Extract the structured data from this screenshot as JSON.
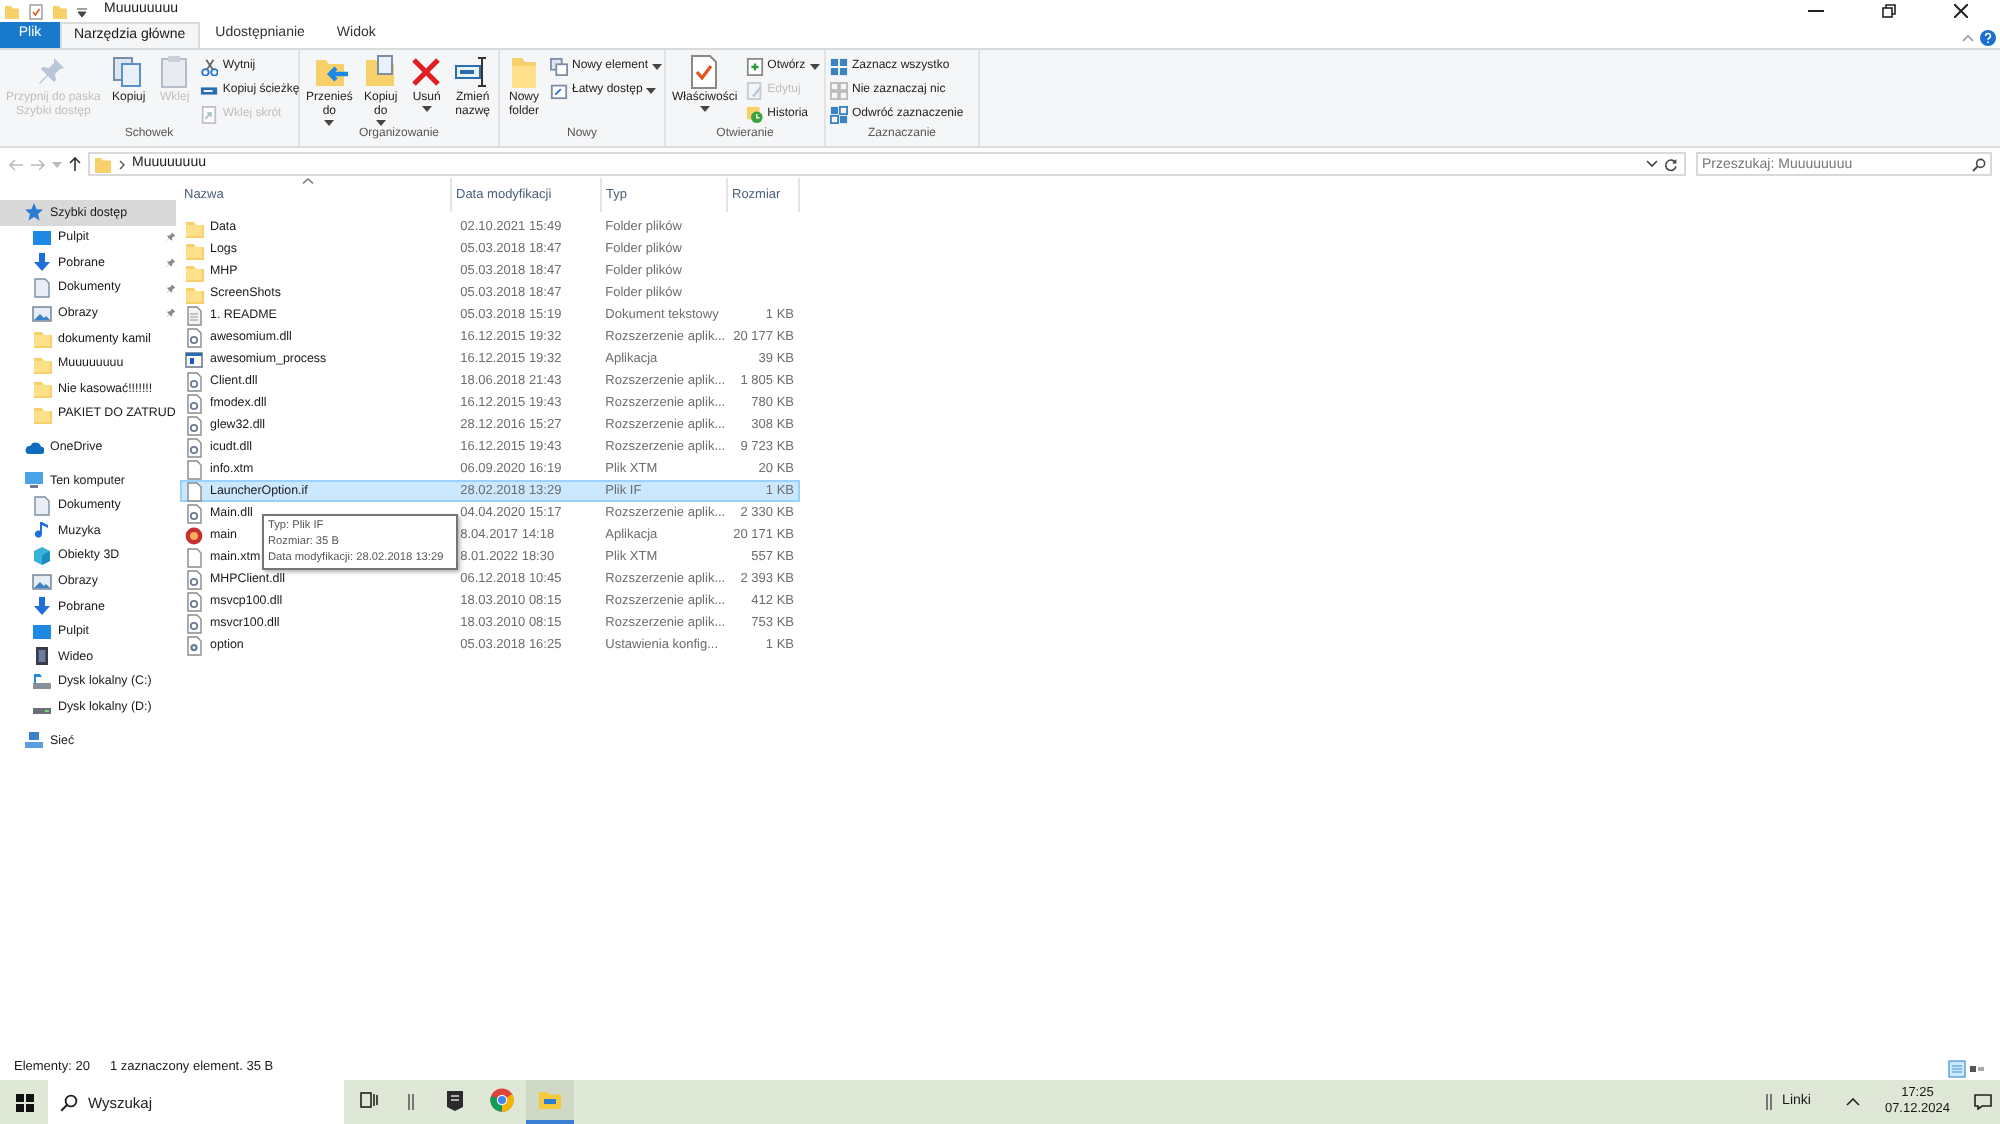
{
  "window": {
    "title": "Muuuuuuuu"
  },
  "tabs": [
    {
      "label": "Plik",
      "kind": "file",
      "selected": false
    },
    {
      "label": "Narzędzia główne",
      "kind": "tab",
      "selected": true
    },
    {
      "label": "Udostępnianie",
      "kind": "tab",
      "selected": false
    },
    {
      "label": "Widok",
      "kind": "tab",
      "selected": false
    }
  ],
  "ribbon": {
    "groups": [
      {
        "label": "Schowek",
        "items": [
          {
            "kind": "big",
            "label": "Przypnij do paska\nSzybki dostęp",
            "disabled": true,
            "dropdown": false
          },
          {
            "kind": "big",
            "label": "Kopiuj",
            "disabled": false,
            "dropdown": false
          },
          {
            "kind": "big",
            "label": "Wklej",
            "disabled": true,
            "dropdown": false
          },
          {
            "kind": "small",
            "label": "Wytnij",
            "disabled": false,
            "dropdown": false
          },
          {
            "kind": "small",
            "label": "Kopiuj ścieżkę",
            "disabled": false,
            "dropdown": false
          },
          {
            "kind": "small",
            "label": "Wklej skrót",
            "disabled": true,
            "dropdown": false
          }
        ]
      },
      {
        "label": "Organizowanie",
        "items": [
          {
            "kind": "big",
            "label": "Przenieś\ndo",
            "disabled": false,
            "dropdown": true
          },
          {
            "kind": "big",
            "label": "Kopiuj\ndo",
            "disabled": false,
            "dropdown": true
          },
          {
            "kind": "big",
            "label": "Usuń",
            "disabled": false,
            "dropdown": true
          },
          {
            "kind": "big",
            "label": "Zmień\nnazwę",
            "disabled": false,
            "dropdown": false
          }
        ]
      },
      {
        "label": "Nowy",
        "items": [
          {
            "kind": "big",
            "label": "Nowy\nfolder",
            "disabled": false,
            "dropdown": false
          },
          {
            "kind": "small",
            "label": "Nowy element",
            "disabled": false,
            "dropdown": true
          },
          {
            "kind": "small",
            "label": "Łatwy dostęp",
            "disabled": false,
            "dropdown": true
          }
        ]
      },
      {
        "label": "Otwieranie",
        "items": [
          {
            "kind": "big",
            "label": "Właściwości",
            "disabled": false,
            "dropdown": true
          },
          {
            "kind": "small",
            "label": "Otwórz",
            "disabled": false,
            "dropdown": true
          },
          {
            "kind": "small",
            "label": "Edytuj",
            "disabled": true,
            "dropdown": false
          },
          {
            "kind": "small",
            "label": "Historia",
            "disabled": false,
            "dropdown": false
          }
        ]
      },
      {
        "label": "Zaznaczanie",
        "items": [
          {
            "kind": "small",
            "label": "Zaznacz wszystko",
            "disabled": false,
            "dropdown": false
          },
          {
            "kind": "small",
            "label": "Nie zaznaczaj nic",
            "disabled": false,
            "dropdown": false
          },
          {
            "kind": "small",
            "label": "Odwróć zaznaczenie",
            "disabled": false,
            "dropdown": false
          }
        ]
      }
    ]
  },
  "address_bar": {
    "path": "Muuuuuuuu",
    "search_placeholder": "Przeszukaj: Muuuuuuuu"
  },
  "sidebar": {
    "items": [
      {
        "label": "Szybki dostęp",
        "selected": true,
        "children": [
          {
            "label": "Pulpit",
            "pinned": true,
            "selected": false
          },
          {
            "label": "Pobrane",
            "pinned": true,
            "selected": false
          },
          {
            "label": "Dokumenty",
            "pinned": true,
            "selected": false
          },
          {
            "label": "Obrazy",
            "pinned": true,
            "selected": false
          },
          {
            "label": "dokumenty kamil",
            "pinned": false,
            "selected": false
          },
          {
            "label": "Muuuuuuuu",
            "pinned": false,
            "selected": false
          },
          {
            "label": "Nie kasować!!!!!!!",
            "pinned": false,
            "selected": false
          },
          {
            "label": "PAKIET DO ZATRUD",
            "pinned": false,
            "selected": false
          }
        ]
      },
      {
        "label": "OneDrive",
        "selected": false
      },
      {
        "label": "Ten komputer",
        "selected": false,
        "children": [
          {
            "label": "Dokumenty",
            "selected": false
          },
          {
            "label": "Muzyka",
            "selected": false
          },
          {
            "label": "Obiekty 3D",
            "selected": false
          },
          {
            "label": "Obrazy",
            "selected": false
          },
          {
            "label": "Pobrane",
            "selected": false
          },
          {
            "label": "Pulpit",
            "selected": false
          },
          {
            "label": "Wideo",
            "selected": false
          },
          {
            "label": "Dysk lokalny (C:)",
            "selected": false
          },
          {
            "label": "Dysk lokalny (D:)",
            "selected": false
          }
        ]
      },
      {
        "label": "Sieć",
        "selected": false
      }
    ]
  },
  "table": {
    "columns": [
      "Nazwa",
      "Data modyfikacji",
      "Typ",
      "Rozmiar"
    ],
    "rows": [
      {
        "kind": "folder",
        "name": "Data",
        "date": "02.10.2021 15:49",
        "type": "Folder plików",
        "size": "",
        "selected": false
      },
      {
        "kind": "folder",
        "name": "Logs",
        "date": "05.03.2018 18:47",
        "type": "Folder plików",
        "size": "",
        "selected": false
      },
      {
        "kind": "folder",
        "name": "MHP",
        "date": "05.03.2018 18:47",
        "type": "Folder plików",
        "size": "",
        "selected": false
      },
      {
        "kind": "folder",
        "name": "ScreenShots",
        "date": "05.03.2018 18:47",
        "type": "Folder plików",
        "size": "",
        "selected": false
      },
      {
        "kind": "text",
        "name": "1. README",
        "date": "05.03.2018 15:19",
        "type": "Dokument tekstowy",
        "size": "1 KB",
        "selected": false
      },
      {
        "kind": "dll",
        "name": "awesomium.dll",
        "date": "16.12.2015 19:32",
        "type": "Rozszerzenie aplik...",
        "size": "20 177 KB",
        "selected": false
      },
      {
        "kind": "app",
        "name": "awesomium_process",
        "date": "16.12.2015 19:32",
        "type": "Aplikacja",
        "size": "39 KB",
        "selected": false
      },
      {
        "kind": "dll",
        "name": "Client.dll",
        "date": "18.06.2018 21:43",
        "type": "Rozszerzenie aplik...",
        "size": "1 805 KB",
        "selected": false
      },
      {
        "kind": "dll",
        "name": "fmodex.dll",
        "date": "16.12.2015 19:43",
        "type": "Rozszerzenie aplik...",
        "size": "780 KB",
        "selected": false
      },
      {
        "kind": "dll",
        "name": "glew32.dll",
        "date": "28.12.2016 15:27",
        "type": "Rozszerzenie aplik...",
        "size": "308 KB",
        "selected": false
      },
      {
        "kind": "dll",
        "name": "icudt.dll",
        "date": "16.12.2015 19:43",
        "type": "Rozszerzenie aplik...",
        "size": "9 723 KB",
        "selected": false
      },
      {
        "kind": "blank",
        "name": "info.xtm",
        "date": "06.09.2020 16:19",
        "type": "Plik XTM",
        "size": "20 KB",
        "selected": false
      },
      {
        "kind": "blank",
        "name": "LauncherOption.if",
        "date": "28.02.2018 13:29",
        "type": "Plik IF",
        "size": "1 KB",
        "selected": true
      },
      {
        "kind": "dll",
        "name": "Main.dll",
        "date": "04.04.2020 15:17",
        "type": "Rozszerzenie aplik...",
        "size": "2 330 KB",
        "selected": false
      },
      {
        "kind": "game",
        "name": "main",
        "date": "8.04.2017 14:18",
        "type": "Aplikacja",
        "size": "20 171 KB",
        "selected": false
      },
      {
        "kind": "blank",
        "name": "main.xtm",
        "date": "8.01.2022 18:30",
        "type": "Plik XTM",
        "size": "557 KB",
        "selected": false
      },
      {
        "kind": "dll",
        "name": "MHPClient.dll",
        "date": "06.12.2018 10:45",
        "type": "Rozszerzenie aplik...",
        "size": "2 393 KB",
        "selected": false
      },
      {
        "kind": "dll",
        "name": "msvcp100.dll",
        "date": "18.03.2010 08:15",
        "type": "Rozszerzenie aplik...",
        "size": "412 KB",
        "selected": false
      },
      {
        "kind": "dll",
        "name": "msvcr100.dll",
        "date": "18.03.2010 08:15",
        "type": "Rozszerzenie aplik...",
        "size": "753 KB",
        "selected": false
      },
      {
        "kind": "config",
        "name": "option",
        "date": "05.03.2018 16:25",
        "type": "Ustawienia konfig...",
        "size": "1 KB",
        "selected": false
      }
    ]
  },
  "tooltip": {
    "lines": [
      "Typ: Plik IF",
      "Rozmiar: 35 B",
      "Data modyfikacji: 28.02.2018 13:29"
    ]
  },
  "status_bar": {
    "count": "Elementy: 20",
    "selection": "1 zaznaczony element. 35 B"
  },
  "taskbar": {
    "search_placeholder": "Wyszukaj",
    "apps": [
      {
        "active": false
      },
      {
        "active": false
      },
      {
        "active": false
      },
      {
        "active": true
      }
    ],
    "links": "Linki",
    "time": "17:25",
    "date": "07.12.2024"
  }
}
